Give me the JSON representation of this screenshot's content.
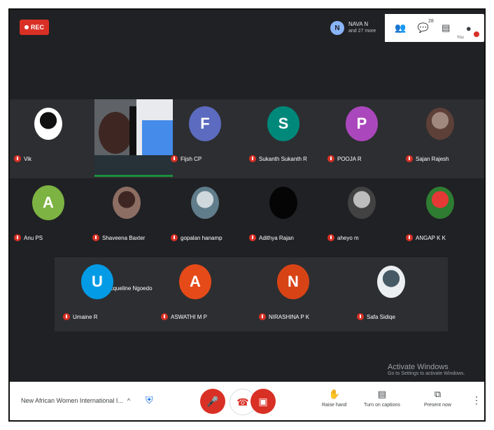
{
  "recording": {
    "label": "REC",
    "color": "#d93025"
  },
  "topbar": {
    "user_initial": "N",
    "user_name": "NAVA N",
    "user_sub": "and 27 more",
    "icons": [
      {
        "name": "people-icon",
        "glyph": "👥",
        "count": ""
      },
      {
        "name": "chat-icon",
        "glyph": "💬",
        "count": "28"
      },
      {
        "name": "activities-icon",
        "glyph": "▤",
        "count": ""
      },
      {
        "name": "user-menu-icon",
        "glyph": "●",
        "small": "You"
      }
    ]
  },
  "participants": [
    {
      "label": "Vik",
      "type": "photo",
      "photo": "bw-logo",
      "row": 1,
      "col": 0
    },
    {
      "label": "Jacqueline Ngoedo",
      "type": "video",
      "row": 1,
      "col": 1
    },
    {
      "label": "Fijsh CP",
      "type": "initial",
      "initial": "F",
      "color": "#5c6bc0",
      "row": 1,
      "col": 2
    },
    {
      "label": "Sukanth Sukanth R",
      "type": "initial",
      "initial": "S",
      "color": "#00897b",
      "row": 1,
      "col": 3
    },
    {
      "label": "POOJA R",
      "type": "initial",
      "initial": "P",
      "color": "#ab47bc",
      "row": 1,
      "col": 4
    },
    {
      "label": "Sajan Rajesh",
      "type": "photo",
      "photo": "person-a",
      "row": 1,
      "col": 5
    },
    {
      "label": "Anu PS",
      "type": "initial",
      "initial": "A",
      "color": "#7cb342",
      "row": 2,
      "col": 0
    },
    {
      "label": "Shaveena Baxter",
      "type": "photo",
      "photo": "person-b",
      "row": 2,
      "col": 1
    },
    {
      "label": "gopalan hanamp",
      "type": "photo",
      "photo": "person-c",
      "row": 2,
      "col": 2
    },
    {
      "label": "Adithya Rajan",
      "type": "photo",
      "photo": "dark",
      "row": 2,
      "col": 3
    },
    {
      "label": "aheyo m",
      "type": "photo",
      "photo": "person-d",
      "row": 2,
      "col": 4
    },
    {
      "label": "ANGAP K K",
      "type": "photo",
      "photo": "flower",
      "row": 2,
      "col": 5
    },
    {
      "label": "Umaine R",
      "type": "initial",
      "initial": "U",
      "color": "#039be5",
      "row": 3,
      "col": 0
    },
    {
      "label": "ASWATHI M P",
      "type": "initial",
      "initial": "A",
      "color": "#e64a19",
      "row": 3,
      "col": 1
    },
    {
      "label": "NIRASHINA P K",
      "type": "initial",
      "initial": "N",
      "color": "#d84315",
      "row": 3,
      "col": 2
    },
    {
      "label": "Safa Sidiqe",
      "type": "photo",
      "photo": "person-e",
      "row": 3,
      "col": 3
    }
  ],
  "watermark": {
    "title": "Activate Windows",
    "sub": "Go to Settings to activate Windows."
  },
  "bottombar": {
    "meeting_name": "New African Women International I...",
    "caret": "^",
    "buttons": [
      {
        "name": "mic-off-button",
        "glyph": "🎤"
      },
      {
        "name": "leave-call-button",
        "glyph": "☎"
      },
      {
        "name": "camera-off-button",
        "glyph": "▣"
      }
    ],
    "utilities": [
      {
        "name": "raise-hand-button",
        "glyph": "✋",
        "label": "Raise hand"
      },
      {
        "name": "captions-button",
        "glyph": "▤",
        "label": "Turn on captions"
      },
      {
        "name": "present-button",
        "glyph": "⧉",
        "label": "Present now"
      }
    ],
    "more": "⋮"
  }
}
